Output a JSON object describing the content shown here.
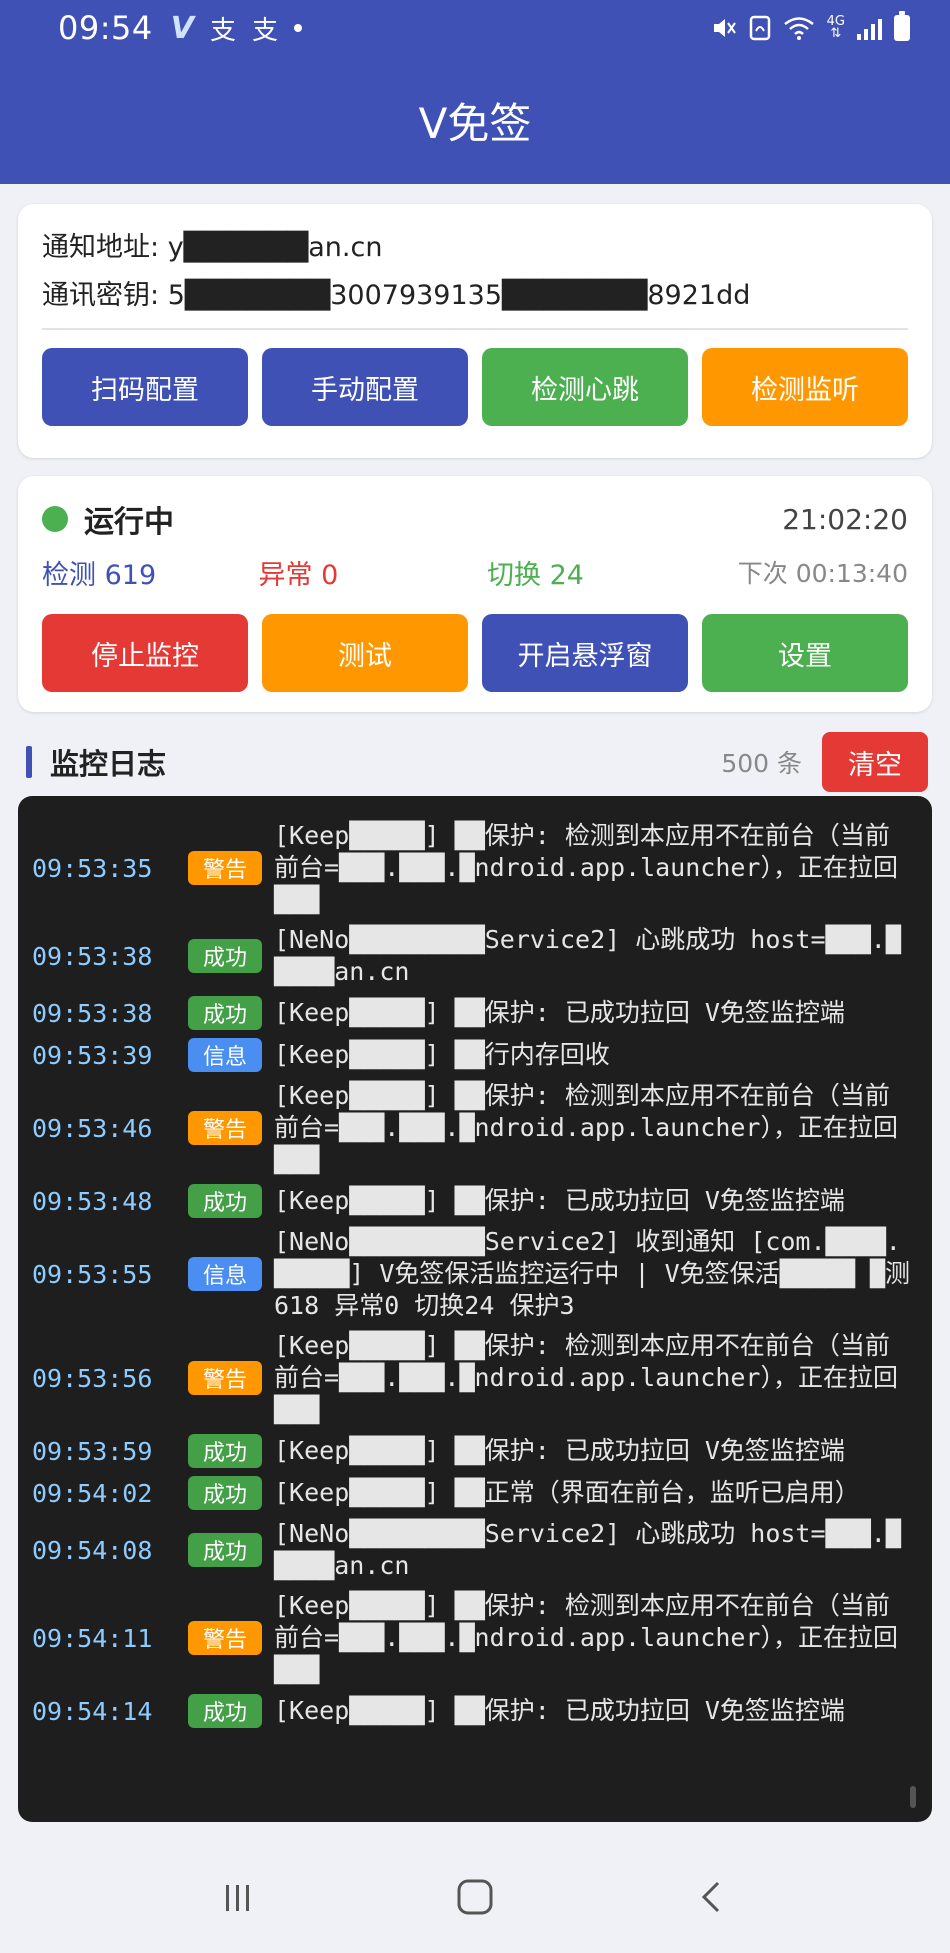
{
  "status_bar": {
    "time": "09:54",
    "network": "4G",
    "notification_icons": [
      "v-app-icon",
      "alipay-icon",
      "alipay-icon",
      "dot-icon"
    ],
    "system_icons": [
      "mute-icon",
      "nfc-icon",
      "wifi-icon",
      "4g-icon",
      "signal-icon",
      "battery-icon"
    ]
  },
  "app_bar": {
    "title": "V免签"
  },
  "config_card": {
    "notify_label": "通知地址:",
    "notify_value": "y██████an.cn",
    "secret_label": "通讯密钥:",
    "secret_value": "5███████3007939135███████8921dd",
    "buttons": [
      "扫码配置",
      "手动配置",
      "检测心跳",
      "检测监听"
    ]
  },
  "status_card": {
    "status": "运行中",
    "time": "21:02:20",
    "detect": "检测 619",
    "error": "异常 0",
    "switch": "切换 24",
    "next": "下次 00:13:40",
    "buttons": [
      "停止监控",
      "测试",
      "开启悬浮窗",
      "设置"
    ]
  },
  "log_header": {
    "title": "监控日志",
    "count": "500 条",
    "clear": "清空"
  },
  "logs": [
    {
      "time": "09:53:35",
      "level": "警告",
      "type": "warn",
      "msg": "[Keep█████] ██保护: 检测到本应用不在前台（当前前台=███.███.█ndroid.app.launcher），正在拉回███"
    },
    {
      "time": "09:53:38",
      "level": "成功",
      "type": "ok",
      "msg": "[NeNo█████████Service2] 心跳成功 host=███.█████an.cn"
    },
    {
      "time": "09:53:38",
      "level": "成功",
      "type": "ok",
      "msg": "[Keep█████] ██保护: 已成功拉回 V免签监控端"
    },
    {
      "time": "09:53:39",
      "level": "信息",
      "type": "info",
      "msg": "[Keep█████] ██行内存回收"
    },
    {
      "time": "09:53:46",
      "level": "警告",
      "type": "warn",
      "msg": "[Keep█████] ██保护: 检测到本应用不在前台（当前前台=███.███.█ndroid.app.launcher），正在拉回███"
    },
    {
      "time": "09:53:48",
      "level": "成功",
      "type": "ok",
      "msg": "[Keep█████] ██保护: 已成功拉回 V免签监控端"
    },
    {
      "time": "09:53:55",
      "level": "信息",
      "type": "info",
      "msg": "[NeNo█████████Service2] 收到通知 [com.████.█████] V免签保活监控运行中 | V免签保活█████ █测618 异常0 切换24 保护3"
    },
    {
      "time": "09:53:56",
      "level": "警告",
      "type": "warn",
      "msg": "[Keep█████] ██保护: 检测到本应用不在前台（当前前台=███.███.█ndroid.app.launcher），正在拉回███"
    },
    {
      "time": "09:53:59",
      "level": "成功",
      "type": "ok",
      "msg": "[Keep█████] ██保护: 已成功拉回 V免签监控端"
    },
    {
      "time": "09:54:02",
      "level": "成功",
      "type": "ok",
      "msg": "[Keep█████] ██正常（界面在前台，监听已启用）"
    },
    {
      "time": "09:54:08",
      "level": "成功",
      "type": "ok",
      "msg": "[NeNo█████████Service2] 心跳成功 host=███.█████an.cn"
    },
    {
      "time": "09:54:11",
      "level": "警告",
      "type": "warn",
      "msg": "[Keep█████] ██保护: 检测到本应用不在前台（当前前台=███.███.█ndroid.app.launcher），正在拉回███"
    },
    {
      "time": "09:54:14",
      "level": "成功",
      "type": "ok",
      "msg": "[Keep█████] ██保护: 已成功拉回 V免签监控端"
    }
  ],
  "nav_bar": {
    "buttons": [
      "recent-apps-icon",
      "home-icon",
      "back-icon"
    ]
  },
  "colors": {
    "primary": "#3f51b5",
    "success": "#4caf50",
    "warning": "#ff9800",
    "danger": "#e53935",
    "info": "#4a8ef2",
    "log_bg": "#1e1e1e"
  }
}
